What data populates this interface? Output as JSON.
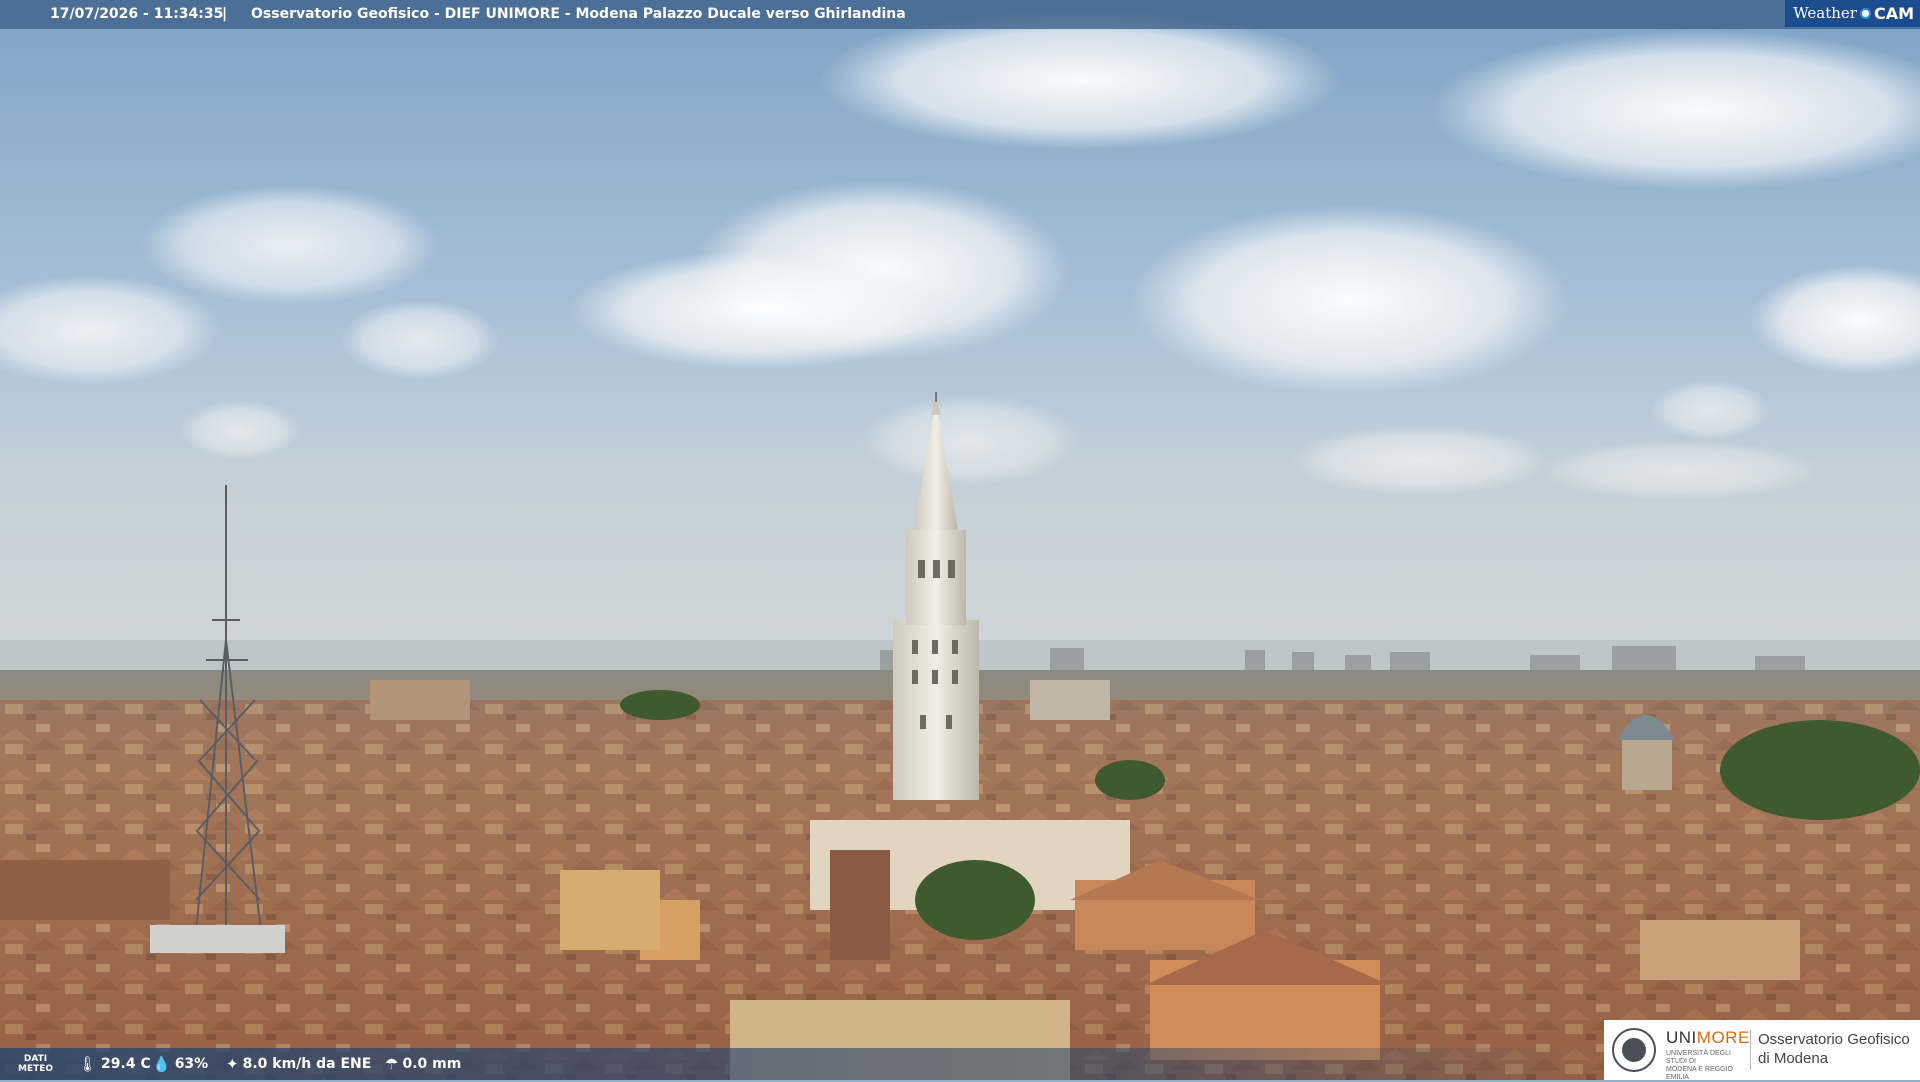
{
  "header": {
    "timestamp": "17/07/2026 - 11:34:35",
    "separator": "|",
    "title": "Osservatorio Geofisico - DIEF UNIMORE - Modena Palazzo Ducale verso Ghirlandina"
  },
  "brand": {
    "weather": "Weather",
    "cam": "CAM"
  },
  "weather_data": {
    "label_line1": "DATI",
    "label_line2": "METEO",
    "temperature": "29.4 C",
    "humidity": "63%",
    "wind": "8.0 km/h da ENE",
    "rain": "0.0 mm"
  },
  "icons": {
    "temperature": "thermometer-icon",
    "humidity": "droplet-icon",
    "wind": "wind-icon",
    "rain": "umbrella-icon"
  },
  "logo": {
    "uni": "UNI",
    "more": "MORE",
    "sub_line1": "UNIVERSITÀ DEGLI STUDI DI",
    "sub_line2": "MODENA E REGGIO EMILIA",
    "obs_line1": "Osservatorio Geofisico",
    "obs_line2": "di Modena"
  },
  "colors": {
    "sky_top": "#86a9c9",
    "sky_bottom": "#c9d4da",
    "roof": "#a86a48",
    "tower": "#e8e4da",
    "overlay": "#3e608a",
    "unimore_orange": "#d96b14"
  }
}
